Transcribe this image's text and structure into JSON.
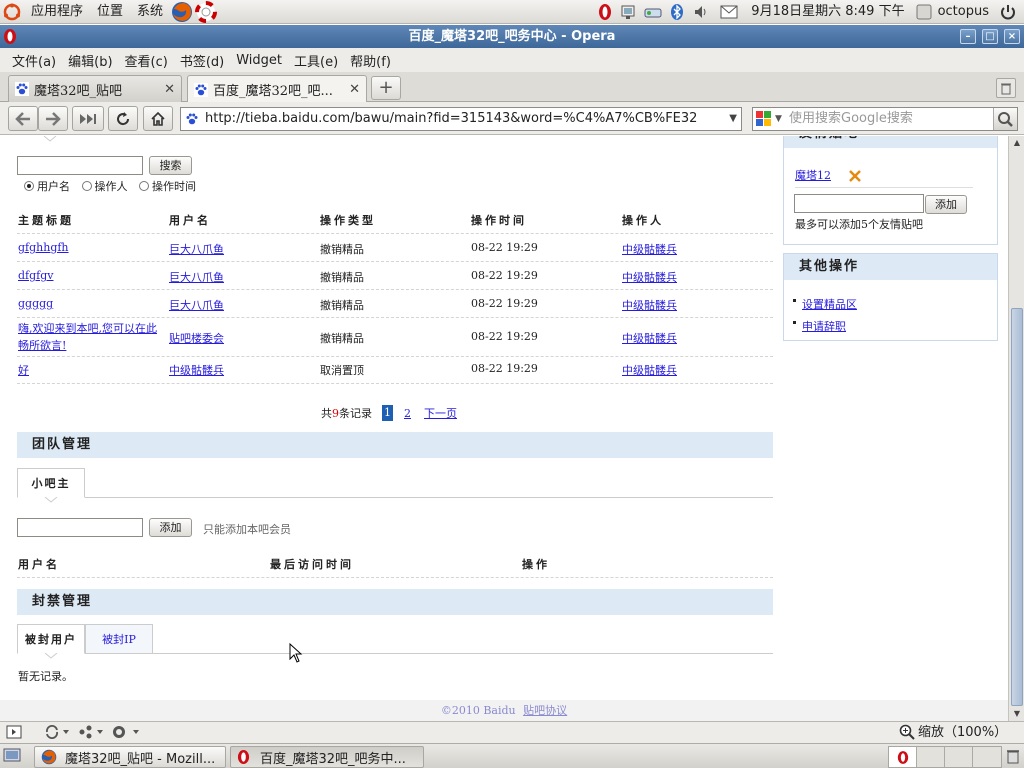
{
  "panel": {
    "menus": [
      "应用程序",
      "位置",
      "系统"
    ],
    "clock": "9月18日星期六  8:49 下午",
    "user": "octopus"
  },
  "window": {
    "title": "百度_魔塔32吧_吧务中心 - Opera"
  },
  "menubar": [
    "文件(a)",
    "编辑(b)",
    "查看(c)",
    "书签(d)",
    "Widget",
    "工具(e)",
    "帮助(f)"
  ],
  "tabs": [
    {
      "label": "魔塔32吧_贴吧"
    },
    {
      "label": "百度_魔塔32吧_吧..."
    }
  ],
  "address": {
    "url": "http://tieba.baidu.com/bawu/main?fid=315143&word=%C4%A7%CB%FE32",
    "search_placeholder": "使用搜索Google搜索"
  },
  "search_form": {
    "button": "搜索",
    "radios": [
      "用户名",
      "操作人",
      "操作时间"
    ]
  },
  "log_table": {
    "headers": [
      "主题标题",
      "用户名",
      "操作类型",
      "操作时间",
      "操作人"
    ],
    "rows": [
      {
        "title": "gfghhgfh",
        "user": "巨大八爪鱼",
        "type": "撤销精品",
        "time": "08-22 19:29",
        "op": "中级骷髅兵"
      },
      {
        "title": "dfgfgv",
        "user": "巨大八爪鱼",
        "type": "撤销精品",
        "time": "08-22 19:29",
        "op": "中级骷髅兵"
      },
      {
        "title": "ggggg",
        "user": "巨大八爪鱼",
        "type": "撤销精品",
        "time": "08-22 19:29",
        "op": "中级骷髅兵"
      },
      {
        "title": "嗨,欢迎来到本吧,您可以在此畅所欲言!",
        "user": "贴吧楼委会",
        "type": "撤销精品",
        "time": "08-22 19:29",
        "op": "中级骷髅兵"
      },
      {
        "title": "好",
        "user": "中级骷髅兵",
        "type": "取消置顶",
        "time": "08-22 19:29",
        "op": "中级骷髅兵"
      }
    ]
  },
  "pagination": {
    "prefix": "共",
    "count": "9",
    "suffix": "条记录",
    "pages": [
      "1",
      "2"
    ],
    "current": "1",
    "next": "下一页"
  },
  "team": {
    "header": "团队管理",
    "tab": "小吧主",
    "add_button": "添加",
    "hint": "只能添加本吧会员",
    "columns": [
      "用户名",
      "最后访问时间",
      "操作"
    ]
  },
  "ban": {
    "header": "封禁管理",
    "tabs": [
      "被封用户",
      "被封IP"
    ],
    "empty": "暂无记录。"
  },
  "friend_box": {
    "header": "友情贴吧",
    "link": "魔塔12",
    "add_button": "添加",
    "hint": "最多可以添加5个友情贴吧"
  },
  "other_ops": {
    "header": "其他操作",
    "links": [
      "设置精品区",
      "申请辞职"
    ]
  },
  "footer": {
    "copyright": "©2010 Baidu",
    "agreement": "贴吧协议"
  },
  "statusbar": {
    "zoom_label": "缩放",
    "zoom_value": "（100%）"
  },
  "taskbar": [
    {
      "label": "魔塔32吧_贴吧 - Mozill..."
    },
    {
      "label": "百度_魔塔32吧_吧务中..."
    }
  ]
}
